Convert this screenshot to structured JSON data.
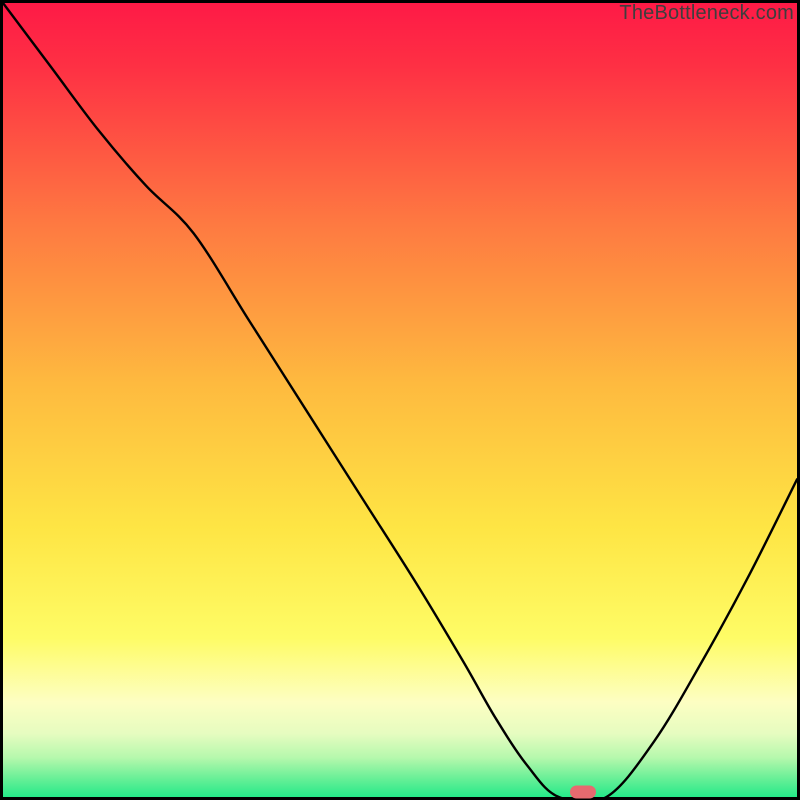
{
  "watermark": "TheBottleneck.com",
  "colors": {
    "gradient_top": "#fe1a46",
    "gradient_mid1": "#fead3f",
    "gradient_mid2": "#feed46",
    "gradient_pale": "#fdfeba",
    "gradient_bottom": "#25e989",
    "curve": "#000000",
    "marker": "#e66a6f",
    "frame": "#000000"
  },
  "chart_data": {
    "type": "line",
    "title": "",
    "xlabel": "",
    "ylabel": "",
    "xlim": [
      0,
      100
    ],
    "ylim": [
      0,
      100
    ],
    "x": [
      0,
      6,
      12,
      18,
      24,
      31,
      38,
      45,
      52,
      58,
      62,
      66,
      70,
      76,
      82,
      88,
      94,
      100
    ],
    "values": [
      100,
      92,
      84,
      77,
      71,
      60,
      49,
      38,
      27,
      17,
      10,
      4,
      0,
      0,
      7,
      17,
      28,
      40
    ],
    "marker_point": {
      "x": 73,
      "y": 0
    },
    "annotations": [
      "TheBottleneck.com"
    ]
  }
}
